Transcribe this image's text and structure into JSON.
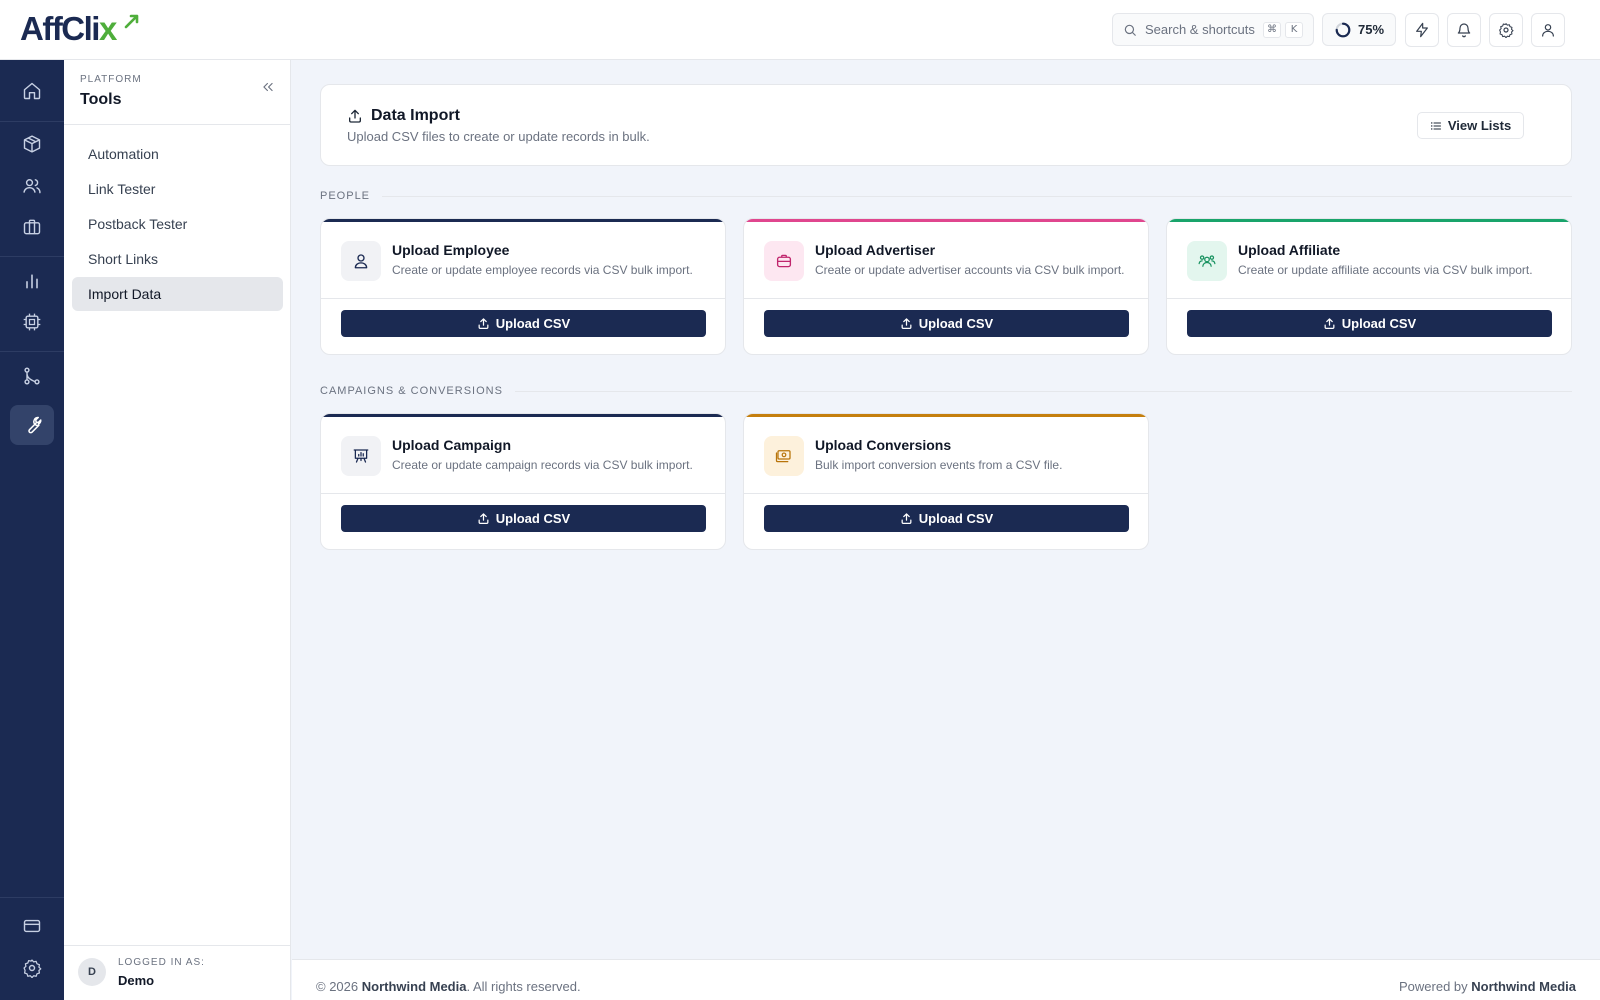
{
  "app": {
    "logo_main": "AffCli",
    "logo_accent": "x"
  },
  "topbar": {
    "search_placeholder": "Search & shortcuts",
    "kbd_cmd": "⌘",
    "kbd_k": "K",
    "progress_label": "75%",
    "progress_value": 0.75
  },
  "sidebar": {
    "kicker": "PLATFORM",
    "title": "Tools",
    "items": [
      {
        "label": "Automation"
      },
      {
        "label": "Link Tester"
      },
      {
        "label": "Postback Tester"
      },
      {
        "label": "Short Links"
      },
      {
        "label": "Import Data"
      }
    ],
    "active_index": 4,
    "footer": {
      "label": "LOGGED IN AS:",
      "user": "Demo",
      "avatar_initial": "D"
    }
  },
  "header": {
    "title": "Data Import",
    "subtitle": "Upload CSV files to create or update records in bulk.",
    "view_lists_label": "View Lists"
  },
  "sections": [
    {
      "label": "PEOPLE",
      "cards": [
        {
          "title": "Upload Employee",
          "description": "Create or update employee records via CSV bulk import.",
          "button": "Upload CSV",
          "accent": "#1b2a52",
          "icon": "user-icon"
        },
        {
          "title": "Upload Advertiser",
          "description": "Create or update advertiser accounts via CSV bulk import.",
          "button": "Upload CSV",
          "accent": "#e0468e",
          "icon": "briefcase-icon"
        },
        {
          "title": "Upload Affiliate",
          "description": "Create or update affiliate accounts via CSV bulk import.",
          "button": "Upload CSV",
          "accent": "#19a46b",
          "icon": "users-group-icon"
        }
      ]
    },
    {
      "label": "CAMPAIGNS & CONVERSIONS",
      "cards": [
        {
          "title": "Upload Campaign",
          "description": "Create or update campaign records via CSV bulk import.",
          "button": "Upload CSV",
          "accent": "#1b2a52",
          "icon": "presentation-chart-icon"
        },
        {
          "title": "Upload Conversions",
          "description": "Bulk import conversion events from a CSV file.",
          "button": "Upload CSV",
          "accent": "#c57f0e",
          "icon": "money-icon"
        }
      ]
    }
  ],
  "footer": {
    "copyright_prefix": "© 2026",
    "company": "Northwind Media",
    "rights": ". All rights reserved.",
    "powered_by": "Powered by",
    "powered_company": "Northwind Media"
  }
}
